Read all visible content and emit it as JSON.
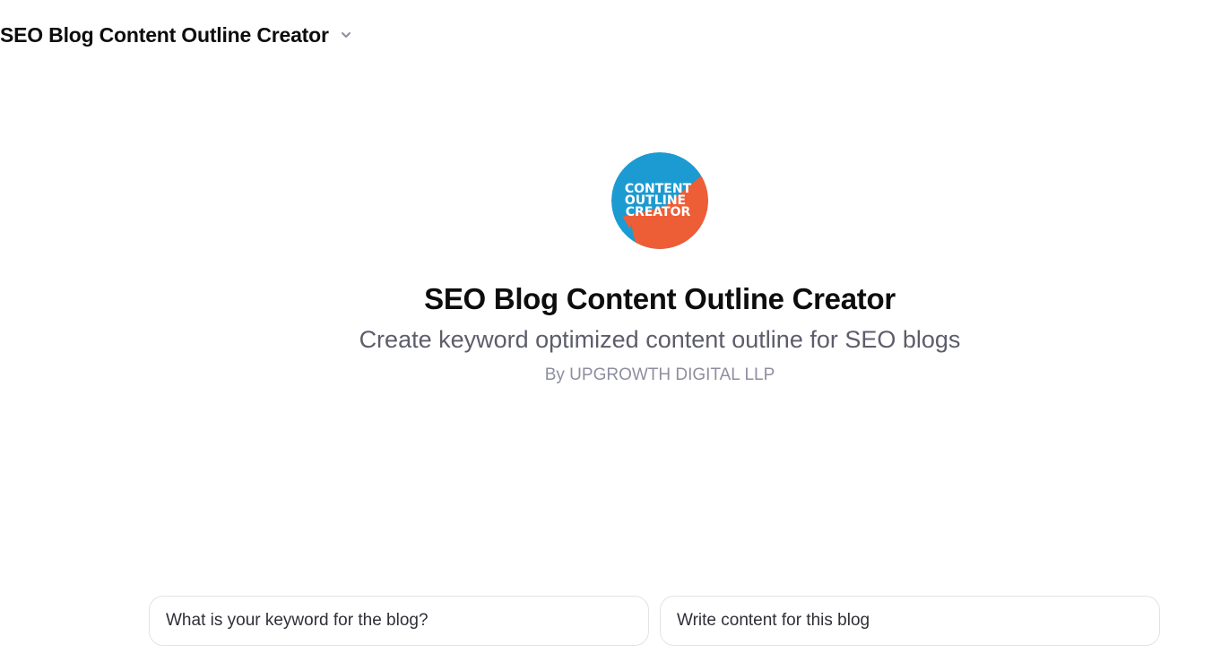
{
  "header": {
    "title": "SEO Blog Content Outline Creator",
    "dropdown_icon": "chevron-down-icon"
  },
  "gpt": {
    "logo": {
      "lines": [
        "CONTENT",
        "OUTLINE",
        "CREATOR"
      ],
      "colors": {
        "blue": "#1b9bd1",
        "orange": "#ee5e36",
        "text": "#ffffff"
      }
    },
    "name": "SEO Blog Content Outline Creator",
    "description": "Create keyword optimized content outline for SEO blogs",
    "author": "By UPGROWTH DIGITAL LLP"
  },
  "conversation_starters": [
    {
      "label": "What is your keyword for the blog?"
    },
    {
      "label": "Write content for this blog"
    }
  ]
}
